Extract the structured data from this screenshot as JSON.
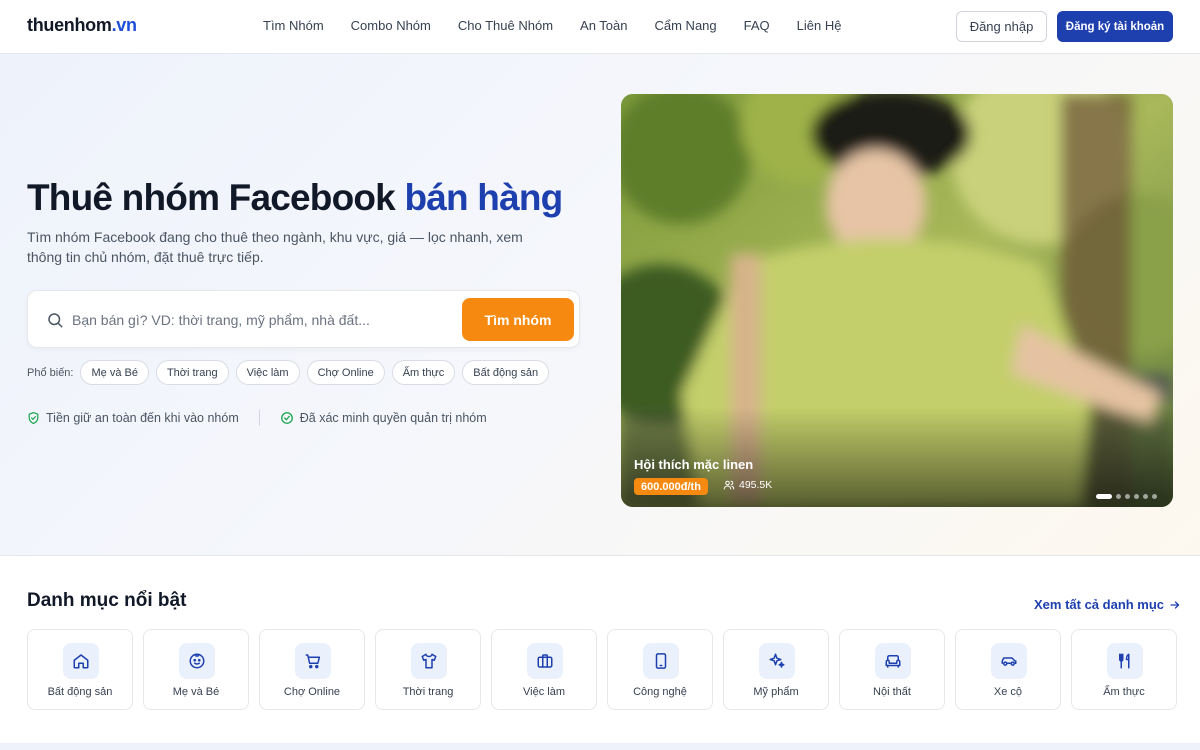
{
  "header": {
    "logo_main": "thuenhom",
    "logo_tld": ".vn",
    "nav": [
      "Tìm Nhóm",
      "Combo Nhóm",
      "Cho Thuê Nhóm",
      "An Toàn",
      "Cẩm Nang",
      "FAQ",
      "Liên Hệ"
    ],
    "login": "Đăng nhập",
    "register": "Đăng ký tài khoản"
  },
  "hero": {
    "title_main": "Thuê nhóm Facebook ",
    "title_highlight": "bán hàng",
    "subtitle": "Tìm nhóm Facebook đang cho thuê theo ngành, khu vực, giá — lọc nhanh, xem thông tin chủ nhóm, đặt thuê trực tiếp.",
    "search_placeholder": "Bạn bán gì? VD: thời trang, mỹ phẩm, nhà đất...",
    "search_button": "Tìm nhóm",
    "popular_label": "Phổ biến:",
    "popular_chips": [
      "Mẹ và Bé",
      "Thời trang",
      "Việc làm",
      "Chợ Online",
      "Ẩm thực",
      "Bất động sản"
    ],
    "trust": [
      "Tiền giữ an toàn đến khi vào nhóm",
      "Đã xác minh quyền quản trị nhóm"
    ],
    "card": {
      "title": "Hội thích mặc linen",
      "price": "600.000đ/th",
      "members": "495.5K",
      "slides": 6,
      "active_slide": 0
    }
  },
  "categories": {
    "title": "Danh mục nổi bật",
    "view_all": "Xem tất cả danh mục",
    "items": [
      {
        "label": "Bất động sản",
        "icon": "home-icon"
      },
      {
        "label": "Mẹ và Bé",
        "icon": "baby-icon"
      },
      {
        "label": "Chợ Online",
        "icon": "cart-icon"
      },
      {
        "label": "Thời trang",
        "icon": "shirt-icon"
      },
      {
        "label": "Việc làm",
        "icon": "briefcase-icon"
      },
      {
        "label": "Công nghệ",
        "icon": "phone-icon"
      },
      {
        "label": "Mỹ phẩm",
        "icon": "sparkles-icon"
      },
      {
        "label": "Nội thất",
        "icon": "sofa-icon"
      },
      {
        "label": "Xe cộ",
        "icon": "car-icon"
      },
      {
        "label": "Ẩm thực",
        "icon": "utensils-icon"
      }
    ]
  },
  "colors": {
    "brand_blue": "#1e40af",
    "accent_orange": "#f68a11",
    "trust_green": "#16a34a"
  }
}
